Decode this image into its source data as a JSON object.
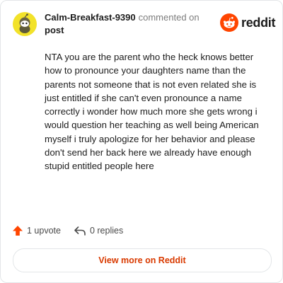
{
  "comment": {
    "author": "Calm-Breakfast-9390",
    "action_text": "commented on",
    "target_link": "post",
    "body": "NTA you are the parent who the heck knows better how to pronounce your daughters name than the parents not someone that is not even related she is just entitled if she can't even pronounce a name correctly i wonder how much more she gets wrong i would question her teaching as well being American myself i truly apologize for her behavior and please don't send her back here we already have enough stupid entitled people here"
  },
  "brand": {
    "name": "reddit",
    "color": "#ff4500"
  },
  "stats": {
    "upvotes_label": "1 upvote",
    "replies_label": "0 replies"
  },
  "cta": {
    "label": "View more on Reddit"
  },
  "icons": {
    "avatar": "snoo-avatar-icon",
    "upvote": "upvote-arrow-icon",
    "reply": "reply-arrow-icon",
    "logo": "reddit-logo-icon"
  },
  "colors": {
    "accent": "#d93a00",
    "upvote": "#ff4500",
    "avatar_bg": "#f2e22a"
  }
}
